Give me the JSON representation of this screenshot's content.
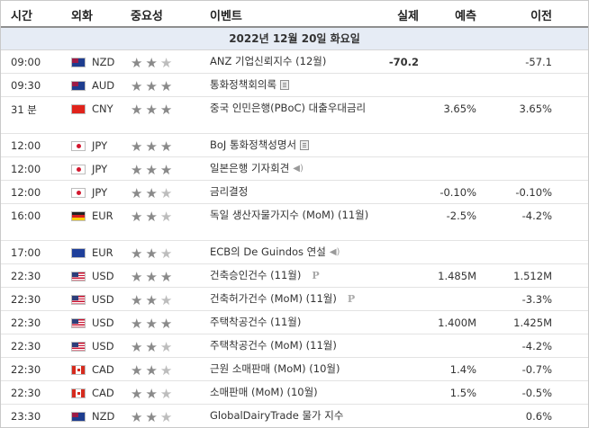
{
  "headers": {
    "time": "시간",
    "currency": "외화",
    "importance": "중요성",
    "event": "이벤트",
    "actual": "실제",
    "forecast": "예측",
    "previous": "이전"
  },
  "date_label": "2022년 12월 20일 화요일",
  "rows": [
    {
      "time": "09:00",
      "flag": "new-zealand-flag-icon",
      "currency": "NZD",
      "stars": 2,
      "event": "ANZ 기업신뢰지수 (12월)",
      "icon": "",
      "actual": "-70.2",
      "forecast": "",
      "previous": "-57.1"
    },
    {
      "time": "09:30",
      "flag": "australia-flag-icon",
      "currency": "AUD",
      "stars": 3,
      "event": "통화정책회의록",
      "icon": "document-icon",
      "actual": "",
      "forecast": "",
      "previous": ""
    },
    {
      "time": "31 분",
      "flag": "china-flag-icon",
      "currency": "CNY",
      "stars": 3,
      "event": "중국 인민은행(PBoC) 대출우대금리",
      "icon": "",
      "actual": "",
      "forecast": "3.65%",
      "previous": "3.65%"
    },
    {
      "time": "12:00",
      "flag": "japan-flag-icon",
      "currency": "JPY",
      "stars": 3,
      "event": "BoJ 통화정책성명서",
      "icon": "document-icon",
      "actual": "",
      "forecast": "",
      "previous": ""
    },
    {
      "time": "12:00",
      "flag": "japan-flag-icon",
      "currency": "JPY",
      "stars": 3,
      "event": "일본은행 기자회견",
      "icon": "speaker-icon",
      "actual": "",
      "forecast": "",
      "previous": ""
    },
    {
      "time": "12:00",
      "flag": "japan-flag-icon",
      "currency": "JPY",
      "stars": 2,
      "event": "금리결정",
      "icon": "",
      "actual": "",
      "forecast": "-0.10%",
      "previous": "-0.10%"
    },
    {
      "time": "16:00",
      "flag": "germany-flag-icon",
      "currency": "EUR",
      "stars": 2,
      "event": "독일 생산자물가지수 (MoM) (11월)",
      "icon": "",
      "actual": "",
      "forecast": "-2.5%",
      "previous": "-4.2%"
    },
    {
      "time": "17:00",
      "flag": "eu-flag-icon",
      "currency": "EUR",
      "stars": 2,
      "event": "ECB의 De Guindos 연설",
      "icon": "speaker-icon",
      "actual": "",
      "forecast": "",
      "previous": ""
    },
    {
      "time": "22:30",
      "flag": "usa-flag-icon",
      "currency": "USD",
      "stars": 3,
      "event": "건축승인건수 (11월)",
      "icon": "preliminary-icon",
      "actual": "",
      "forecast": "1.485M",
      "previous": "1.512M"
    },
    {
      "time": "22:30",
      "flag": "usa-flag-icon",
      "currency": "USD",
      "stars": 2,
      "event": "건축허가건수 (MoM) (11월)",
      "icon": "preliminary-icon",
      "actual": "",
      "forecast": "",
      "previous": "-3.3%"
    },
    {
      "time": "22:30",
      "flag": "usa-flag-icon",
      "currency": "USD",
      "stars": 3,
      "event": "주택착공건수 (11월)",
      "icon": "",
      "actual": "",
      "forecast": "1.400M",
      "previous": "1.425M"
    },
    {
      "time": "22:30",
      "flag": "usa-flag-icon",
      "currency": "USD",
      "stars": 2,
      "event": "주택착공건수 (MoM) (11월)",
      "icon": "",
      "actual": "",
      "forecast": "",
      "previous": "-4.2%"
    },
    {
      "time": "22:30",
      "flag": "canada-flag-icon",
      "currency": "CAD",
      "stars": 2,
      "event": "근원 소매판매 (MoM) (10월)",
      "icon": "",
      "actual": "",
      "forecast": "1.4%",
      "previous": "-0.7%"
    },
    {
      "time": "22:30",
      "flag": "canada-flag-icon",
      "currency": "CAD",
      "stars": 2,
      "event": "소매판매 (MoM) (10월)",
      "icon": "",
      "actual": "",
      "forecast": "1.5%",
      "previous": "-0.5%"
    },
    {
      "time": "23:30",
      "flag": "new-zealand-flag-icon",
      "currency": "NZD",
      "stars": 2,
      "event": "GlobalDairyTrade 물가 지수",
      "icon": "",
      "actual": "",
      "forecast": "",
      "previous": "0.6%"
    }
  ],
  "glyphs": {
    "star": "★",
    "speaker": "◀)",
    "preliminary": "P"
  }
}
